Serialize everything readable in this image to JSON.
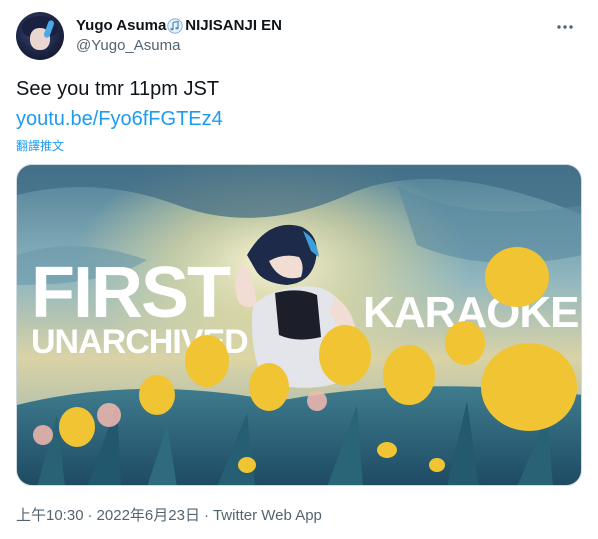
{
  "author": {
    "display_name_prefix": "Yugo Asuma",
    "display_name_suffix": "NIJISANJI EN",
    "handle": "@Yugo_Asuma",
    "avatar_icon": "avatar-portrait"
  },
  "tweet": {
    "text": "See you tmr 11pm JST",
    "link": "youtu.be/Fyo6fFGTEz4",
    "translate_label": "翻譯推文"
  },
  "media": {
    "title_line1": "FIRST",
    "title_line2": "UNARCHIVED",
    "title_right": "KARAOKE"
  },
  "meta": {
    "time": "上午10:30",
    "date": "2022年6月23日",
    "source": "Twitter Web App",
    "separator": "·"
  },
  "colors": {
    "link": "#1d9bf0",
    "secondary": "#536471",
    "primary_text": "#0f1419"
  },
  "icons": {
    "more": "more-horizontal-icon",
    "music": "music-note-icon"
  }
}
